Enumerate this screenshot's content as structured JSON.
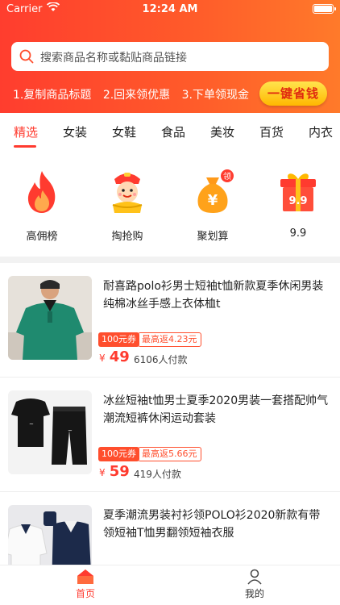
{
  "status_bar": {
    "carrier": "Carrier",
    "time": "12:24 AM"
  },
  "search": {
    "placeholder": "搜索商品名称或黏贴商品链接"
  },
  "steps": [
    "1.复制商品标题",
    "2.回来领优惠",
    "3.下单领现金"
  ],
  "cta_label": "一键省钱",
  "tabs": [
    "精选",
    "女装",
    "女鞋",
    "食品",
    "美妆",
    "百货",
    "内衣"
  ],
  "categories": [
    {
      "label": "高佣榜",
      "icon": "flame-icon"
    },
    {
      "label": "掏抢购",
      "icon": "mascot-icon"
    },
    {
      "label": "聚划算",
      "icon": "money-bag-icon",
      "badge": "领"
    },
    {
      "label": "9.9",
      "icon": "gift-box-icon",
      "badge": "9.9"
    }
  ],
  "products": [
    {
      "title": "耐喜路polo衫男士短袖t恤新款夏季休闲男装纯棉冰丝手感上衣体桖t",
      "coupon": "100元券",
      "rebate": "最高返4.23元",
      "currency": "¥",
      "price": "49",
      "sold": "6106人付款"
    },
    {
      "title": "冰丝短袖t恤男士夏季2020男装一套搭配帅气潮流短裤休闲运动套装",
      "coupon": "100元券",
      "rebate": "最高返5.66元",
      "currency": "¥",
      "price": "59",
      "sold": "419人付款"
    },
    {
      "title": "夏季潮流男装衬衫领POLO衫2020新款有带领短袖T恤男翻领短袖衣服"
    }
  ],
  "bottom_nav": [
    {
      "label": "首页",
      "icon": "home-icon"
    },
    {
      "label": "我的",
      "icon": "user-icon"
    }
  ],
  "colors": {
    "accent": "#ff3b2f",
    "header_start": "#ff3d2e",
    "header_end": "#ff7a2a",
    "cta": "#ffc21a"
  }
}
